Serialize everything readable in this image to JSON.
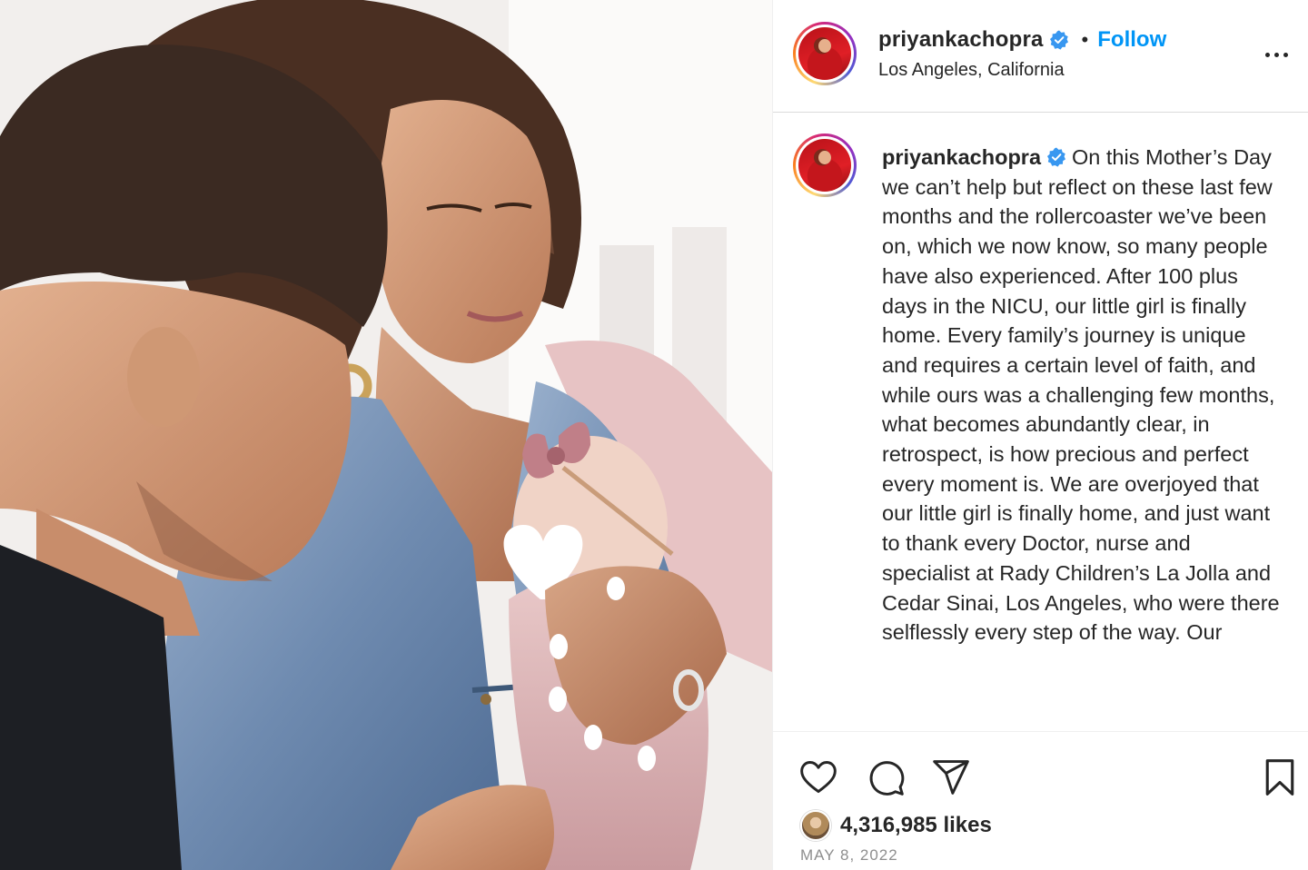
{
  "header": {
    "username": "priyankachopra",
    "separator": "•",
    "follow_label": "Follow",
    "location": "Los Angeles, California",
    "more_icon": "more-horizontal-icon"
  },
  "caption": {
    "username": "priyankachopra",
    "text": "On this Mother’s Day we can’t help but reflect on these last few months and the rollercoaster we’ve been on, which we now know, so many people have also experienced. After 100 plus days in the NICU, our little girl is finally home. Every family’s journey is unique and requires a certain level of faith, and while ours was a challenging few months, what becomes abundantly clear, in retrospect, is how precious and perfect every moment is. We are overjoyed that our little girl is finally home, and just want to thank every Doctor, nurse and specialist at Rady Children’s La Jolla and Cedar Sinai, Los Angeles, who were there selflessly every step of the way. Our"
  },
  "actions": {
    "icons": [
      "heart-icon",
      "comment-icon",
      "share-icon",
      "bookmark-icon"
    ]
  },
  "likes": {
    "count_text": "4,316,985 likes"
  },
  "date": "MAY 8, 2022",
  "colors": {
    "accent": "#0095f6",
    "text": "#262626",
    "muted": "#8e8e8e",
    "verified": "#3897f0"
  }
}
